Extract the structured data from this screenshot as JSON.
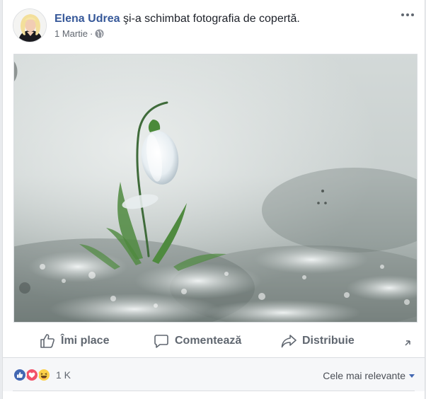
{
  "post": {
    "author": "Elena Udrea",
    "action": "şi-a schimbat fotografia de copertă.",
    "date": "1 Martie",
    "separator": "·",
    "privacy_icon": "globe-icon",
    "more_icon": "more-dots-icon",
    "photo_subject": "snowdrop-flower-photo"
  },
  "actions": {
    "like_label": "Îmi place",
    "comment_label": "Comentează",
    "share_label": "Distribuie",
    "like_icon": "thumbs-up-outline-icon",
    "comment_icon": "comment-bubble-icon",
    "share_icon": "share-arrow-icon"
  },
  "reactions": {
    "icons": [
      "like-reaction-icon",
      "love-reaction-icon",
      "haha-reaction-icon"
    ],
    "count": "1 K",
    "sort_label": "Cele mai relevante"
  },
  "colors": {
    "author_link": "#365899",
    "like_blue": "#4267b2",
    "love_red": "#f25268",
    "haha_yellow": "#fcd149",
    "muted_text": "#616770"
  }
}
